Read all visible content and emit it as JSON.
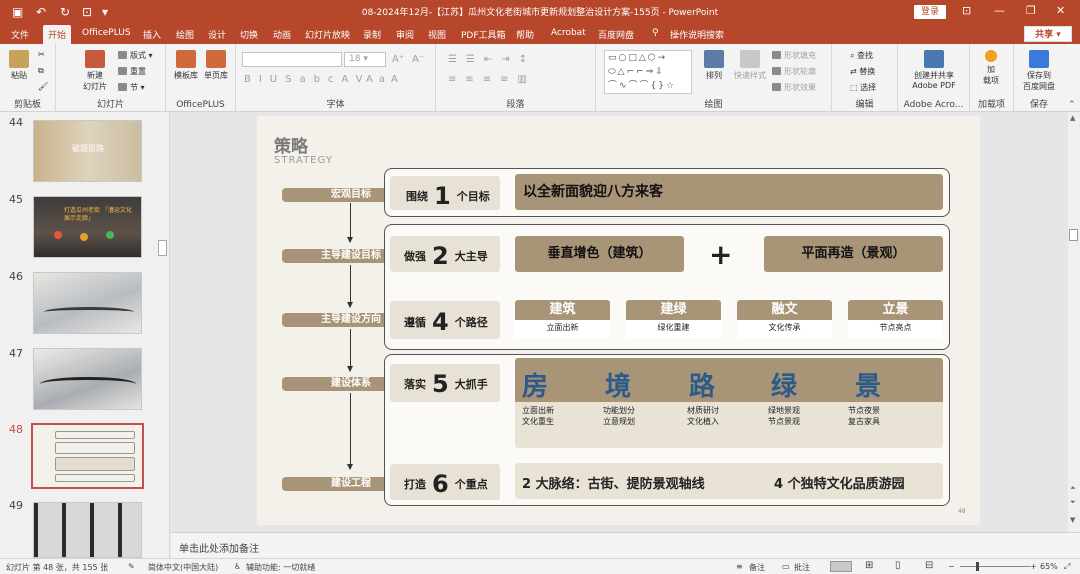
{
  "window": {
    "title": "08-2024年12月-【江苏】瓜州文化老街城市更新规划整治设计方案-155页 - PowerPoint",
    "login_label": "登录"
  },
  "tabs": [
    "文件",
    "开始",
    "OfficePLUS",
    "插入",
    "绘图",
    "设计",
    "切换",
    "动画",
    "幻灯片放映",
    "录制",
    "审阅",
    "视图",
    "PDF工具箱",
    "帮助",
    "Acrobat",
    "百度网盘",
    "操作说明搜索"
  ],
  "share_label": "共享",
  "ribbon": {
    "clipboard": {
      "paste": "粘贴",
      "group": "剪贴板"
    },
    "slides": {
      "new_slide": "新建\n幻灯片",
      "layout": "版式",
      "reset": "重置",
      "section": "节",
      "group": "幻灯片"
    },
    "officeplus": {
      "template": "模板库",
      "single": "单页库",
      "group": "OfficePLUS"
    },
    "font": {
      "font_name": "",
      "font_size": "18",
      "group": "字体"
    },
    "paragraph": {
      "group": "段落"
    },
    "drawing": {
      "arrange": "排列",
      "quick_styles": "快速样式",
      "fill": "形状填充",
      "outline": "形状轮廓",
      "effects": "形状效果",
      "group": "绘图"
    },
    "editing": {
      "find": "查找",
      "replace": "替换",
      "select": "选择",
      "group": "编辑"
    },
    "adobe": {
      "create": "创建并共享\nAdobe PDF",
      "group": "Adobe Acro..."
    },
    "addins": {
      "add": "加\n载项",
      "group": "加载项"
    },
    "save": {
      "save": "保存到\n百度网盘",
      "group": "保存"
    }
  },
  "thumbnails": [
    {
      "num": "44",
      "label": "破题思路"
    },
    {
      "num": "45",
      "label": "打造瓜州老街 「漕运文化展示走廊」"
    },
    {
      "num": "46",
      "label": ""
    },
    {
      "num": "47",
      "label": ""
    },
    {
      "num": "48",
      "label": ""
    },
    {
      "num": "49",
      "label": ""
    }
  ],
  "slide": {
    "title": "策略",
    "title_en": "STRATEGY",
    "left_labels": [
      "宏观目标",
      "主导建设目标",
      "主导建设方向",
      "建设体系",
      "建设工程"
    ],
    "row1": {
      "pre": "围绕",
      "num": "1",
      "post": "个目标",
      "text": "以全新面貌迎八方来客"
    },
    "row2": {
      "pre": "做强",
      "num": "2",
      "post": "大主导",
      "left": "垂直增色（建筑）",
      "plus": "+",
      "right": "平面再造（景观）"
    },
    "row3": {
      "pre": "遵循",
      "num": "4",
      "post": "个路径",
      "paths": [
        {
          "title": "建筑",
          "desc": "立面出新"
        },
        {
          "title": "建绿",
          "desc": "绿化重建"
        },
        {
          "title": "融文",
          "desc": "文化传承"
        },
        {
          "title": "立景",
          "desc": "节点亮点"
        }
      ]
    },
    "row4": {
      "pre": "落实",
      "num": "5",
      "post": "大抓手",
      "items": [
        {
          "char": "房",
          "l1": "立面出新",
          "l2": "文化重生"
        },
        {
          "char": "境",
          "l1": "功能划分",
          "l2": "立意规划"
        },
        {
          "char": "路",
          "l1": "材质研讨",
          "l2": "文化植入"
        },
        {
          "char": "绿",
          "l1": "绿地景观",
          "l2": "节点景观"
        },
        {
          "char": "景",
          "l1": "节点夜景",
          "l2": "复古家具"
        }
      ]
    },
    "row5": {
      "pre": "打造",
      "num": "6",
      "post": "个重点",
      "left": "2 大脉络：古街、提防景观轴线",
      "right": "4 个独特文化品质游园"
    },
    "page_number": "48"
  },
  "notes_placeholder": "单击此处添加备注",
  "status": {
    "slide_info": "幻灯片 第 48 张，共 155 张",
    "language": "简体中文(中国大陆)",
    "accessibility": "辅助功能: 一切就绪",
    "notes": "备注",
    "comments": "批注",
    "zoom": "65%"
  }
}
